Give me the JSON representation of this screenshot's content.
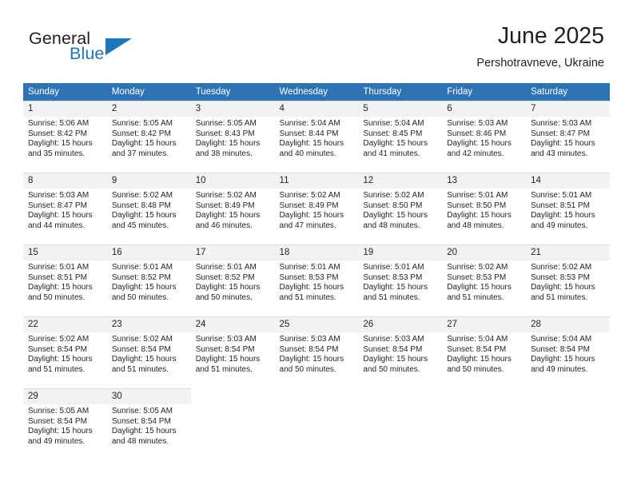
{
  "brand": {
    "name_part1": "General",
    "name_part2": "Blue",
    "flag_icon": "triangle-flag-icon"
  },
  "header": {
    "month_title": "June 2025",
    "location": "Pershotravneve, Ukraine"
  },
  "colors": {
    "header_blue": "#2e74b5",
    "daynum_gray": "#f2f2f2",
    "brand_blue": "#1c76bc",
    "text": "#231f20",
    "grid_line": "#dcdcdc"
  },
  "calendar": {
    "weekday_headers": [
      "Sunday",
      "Monday",
      "Tuesday",
      "Wednesday",
      "Thursday",
      "Friday",
      "Saturday"
    ],
    "weeks": [
      [
        {
          "day": "1",
          "sunrise": "Sunrise: 5:06 AM",
          "sunset": "Sunset: 8:42 PM",
          "daylight1": "Daylight: 15 hours",
          "daylight2": "and 35 minutes."
        },
        {
          "day": "2",
          "sunrise": "Sunrise: 5:05 AM",
          "sunset": "Sunset: 8:42 PM",
          "daylight1": "Daylight: 15 hours",
          "daylight2": "and 37 minutes."
        },
        {
          "day": "3",
          "sunrise": "Sunrise: 5:05 AM",
          "sunset": "Sunset: 8:43 PM",
          "daylight1": "Daylight: 15 hours",
          "daylight2": "and 38 minutes."
        },
        {
          "day": "4",
          "sunrise": "Sunrise: 5:04 AM",
          "sunset": "Sunset: 8:44 PM",
          "daylight1": "Daylight: 15 hours",
          "daylight2": "and 40 minutes."
        },
        {
          "day": "5",
          "sunrise": "Sunrise: 5:04 AM",
          "sunset": "Sunset: 8:45 PM",
          "daylight1": "Daylight: 15 hours",
          "daylight2": "and 41 minutes."
        },
        {
          "day": "6",
          "sunrise": "Sunrise: 5:03 AM",
          "sunset": "Sunset: 8:46 PM",
          "daylight1": "Daylight: 15 hours",
          "daylight2": "and 42 minutes."
        },
        {
          "day": "7",
          "sunrise": "Sunrise: 5:03 AM",
          "sunset": "Sunset: 8:47 PM",
          "daylight1": "Daylight: 15 hours",
          "daylight2": "and 43 minutes."
        }
      ],
      [
        {
          "day": "8",
          "sunrise": "Sunrise: 5:03 AM",
          "sunset": "Sunset: 8:47 PM",
          "daylight1": "Daylight: 15 hours",
          "daylight2": "and 44 minutes."
        },
        {
          "day": "9",
          "sunrise": "Sunrise: 5:02 AM",
          "sunset": "Sunset: 8:48 PM",
          "daylight1": "Daylight: 15 hours",
          "daylight2": "and 45 minutes."
        },
        {
          "day": "10",
          "sunrise": "Sunrise: 5:02 AM",
          "sunset": "Sunset: 8:49 PM",
          "daylight1": "Daylight: 15 hours",
          "daylight2": "and 46 minutes."
        },
        {
          "day": "11",
          "sunrise": "Sunrise: 5:02 AM",
          "sunset": "Sunset: 8:49 PM",
          "daylight1": "Daylight: 15 hours",
          "daylight2": "and 47 minutes."
        },
        {
          "day": "12",
          "sunrise": "Sunrise: 5:02 AM",
          "sunset": "Sunset: 8:50 PM",
          "daylight1": "Daylight: 15 hours",
          "daylight2": "and 48 minutes."
        },
        {
          "day": "13",
          "sunrise": "Sunrise: 5:01 AM",
          "sunset": "Sunset: 8:50 PM",
          "daylight1": "Daylight: 15 hours",
          "daylight2": "and 48 minutes."
        },
        {
          "day": "14",
          "sunrise": "Sunrise: 5:01 AM",
          "sunset": "Sunset: 8:51 PM",
          "daylight1": "Daylight: 15 hours",
          "daylight2": "and 49 minutes."
        }
      ],
      [
        {
          "day": "15",
          "sunrise": "Sunrise: 5:01 AM",
          "sunset": "Sunset: 8:51 PM",
          "daylight1": "Daylight: 15 hours",
          "daylight2": "and 50 minutes."
        },
        {
          "day": "16",
          "sunrise": "Sunrise: 5:01 AM",
          "sunset": "Sunset: 8:52 PM",
          "daylight1": "Daylight: 15 hours",
          "daylight2": "and 50 minutes."
        },
        {
          "day": "17",
          "sunrise": "Sunrise: 5:01 AM",
          "sunset": "Sunset: 8:52 PM",
          "daylight1": "Daylight: 15 hours",
          "daylight2": "and 50 minutes."
        },
        {
          "day": "18",
          "sunrise": "Sunrise: 5:01 AM",
          "sunset": "Sunset: 8:53 PM",
          "daylight1": "Daylight: 15 hours",
          "daylight2": "and 51 minutes."
        },
        {
          "day": "19",
          "sunrise": "Sunrise: 5:01 AM",
          "sunset": "Sunset: 8:53 PM",
          "daylight1": "Daylight: 15 hours",
          "daylight2": "and 51 minutes."
        },
        {
          "day": "20",
          "sunrise": "Sunrise: 5:02 AM",
          "sunset": "Sunset: 8:53 PM",
          "daylight1": "Daylight: 15 hours",
          "daylight2": "and 51 minutes."
        },
        {
          "day": "21",
          "sunrise": "Sunrise: 5:02 AM",
          "sunset": "Sunset: 8:53 PM",
          "daylight1": "Daylight: 15 hours",
          "daylight2": "and 51 minutes."
        }
      ],
      [
        {
          "day": "22",
          "sunrise": "Sunrise: 5:02 AM",
          "sunset": "Sunset: 8:54 PM",
          "daylight1": "Daylight: 15 hours",
          "daylight2": "and 51 minutes."
        },
        {
          "day": "23",
          "sunrise": "Sunrise: 5:02 AM",
          "sunset": "Sunset: 8:54 PM",
          "daylight1": "Daylight: 15 hours",
          "daylight2": "and 51 minutes."
        },
        {
          "day": "24",
          "sunrise": "Sunrise: 5:03 AM",
          "sunset": "Sunset: 8:54 PM",
          "daylight1": "Daylight: 15 hours",
          "daylight2": "and 51 minutes."
        },
        {
          "day": "25",
          "sunrise": "Sunrise: 5:03 AM",
          "sunset": "Sunset: 8:54 PM",
          "daylight1": "Daylight: 15 hours",
          "daylight2": "and 50 minutes."
        },
        {
          "day": "26",
          "sunrise": "Sunrise: 5:03 AM",
          "sunset": "Sunset: 8:54 PM",
          "daylight1": "Daylight: 15 hours",
          "daylight2": "and 50 minutes."
        },
        {
          "day": "27",
          "sunrise": "Sunrise: 5:04 AM",
          "sunset": "Sunset: 8:54 PM",
          "daylight1": "Daylight: 15 hours",
          "daylight2": "and 50 minutes."
        },
        {
          "day": "28",
          "sunrise": "Sunrise: 5:04 AM",
          "sunset": "Sunset: 8:54 PM",
          "daylight1": "Daylight: 15 hours",
          "daylight2": "and 49 minutes."
        }
      ],
      [
        {
          "day": "29",
          "sunrise": "Sunrise: 5:05 AM",
          "sunset": "Sunset: 8:54 PM",
          "daylight1": "Daylight: 15 hours",
          "daylight2": "and 49 minutes."
        },
        {
          "day": "30",
          "sunrise": "Sunrise: 5:05 AM",
          "sunset": "Sunset: 8:54 PM",
          "daylight1": "Daylight: 15 hours",
          "daylight2": "and 48 minutes."
        },
        null,
        null,
        null,
        null,
        null
      ]
    ]
  }
}
